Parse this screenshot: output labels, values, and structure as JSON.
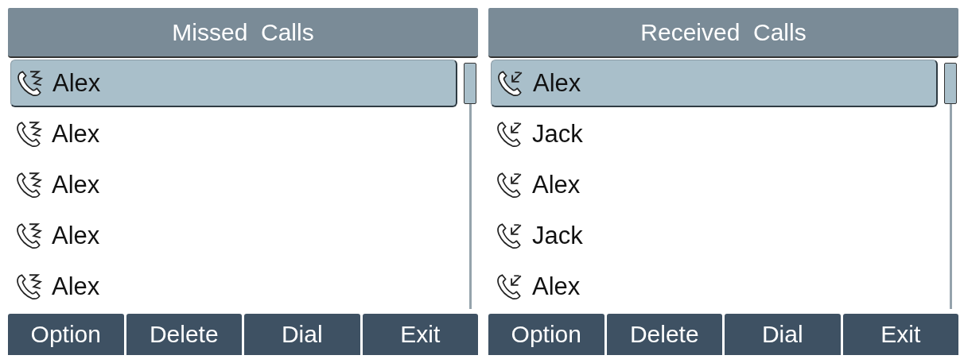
{
  "screens": [
    {
      "title": "Missed  Calls",
      "kind": "missed",
      "calls": [
        {
          "name": "Alex",
          "selected": true
        },
        {
          "name": "Alex",
          "selected": false
        },
        {
          "name": "Alex",
          "selected": false
        },
        {
          "name": "Alex",
          "selected": false
        },
        {
          "name": "Alex",
          "selected": false
        }
      ],
      "softkeys": [
        "Option",
        "Delete",
        "Dial",
        "Exit"
      ]
    },
    {
      "title": "Received  Calls",
      "kind": "received",
      "calls": [
        {
          "name": "Alex",
          "selected": true
        },
        {
          "name": "Jack",
          "selected": false
        },
        {
          "name": "Alex",
          "selected": false
        },
        {
          "name": "Jack",
          "selected": false
        },
        {
          "name": "Alex",
          "selected": false
        }
      ],
      "softkeys": [
        "Option",
        "Delete",
        "Dial",
        "Exit"
      ]
    }
  ]
}
